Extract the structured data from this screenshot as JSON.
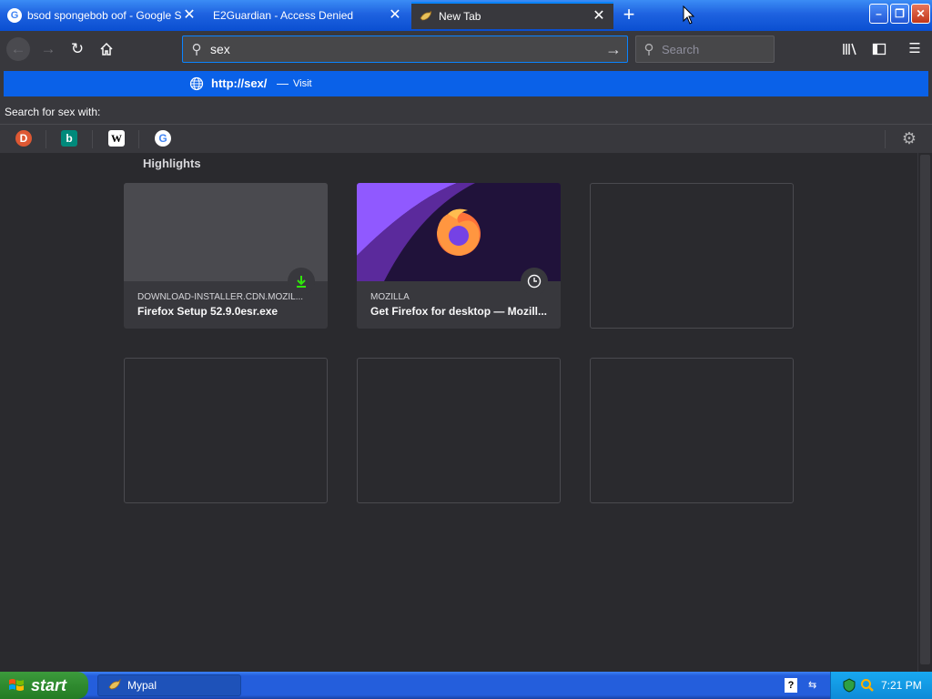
{
  "tabs": [
    {
      "title": "bsod spongebob oof - Google Search",
      "favicon": "google-icon",
      "close": "✕"
    },
    {
      "title": "E2Guardian - Access Denied",
      "favicon": "none",
      "close": "✕"
    },
    {
      "title": "New Tab",
      "favicon": "mypal-icon",
      "close": "✕",
      "selected": true
    }
  ],
  "new_tab_label": "+",
  "window_buttons": {
    "minimize": "–",
    "restore": "❐",
    "close": "✕"
  },
  "urlbar": {
    "value": "sex"
  },
  "searchbar": {
    "placeholder": "Search"
  },
  "autocomplete": {
    "url": "http://sex/",
    "separator": "—",
    "action": "Visit"
  },
  "search_with": "Search for sex with:",
  "engines": [
    "duckduckgo-icon",
    "bing-icon",
    "wikipedia-icon",
    "google-icon"
  ],
  "highlights": {
    "title": "Highlights",
    "cards": [
      {
        "host": "DOWNLOAD-INSTALLER.CDN.MOZIL...",
        "title": "Firefox Setup 52.9.0esr.exe",
        "badge": "download-icon"
      },
      {
        "host": "MOZILLA",
        "title": "Get Firefox for desktop — Mozill...",
        "badge": "clock-icon"
      }
    ]
  },
  "taskbar": {
    "start_label": "start",
    "task_item": "Mypal",
    "clock": "7:21 PM"
  },
  "colors": {
    "accent": "#0a84ff",
    "toolbar": "#38383d",
    "content": "#2a2a2e"
  }
}
